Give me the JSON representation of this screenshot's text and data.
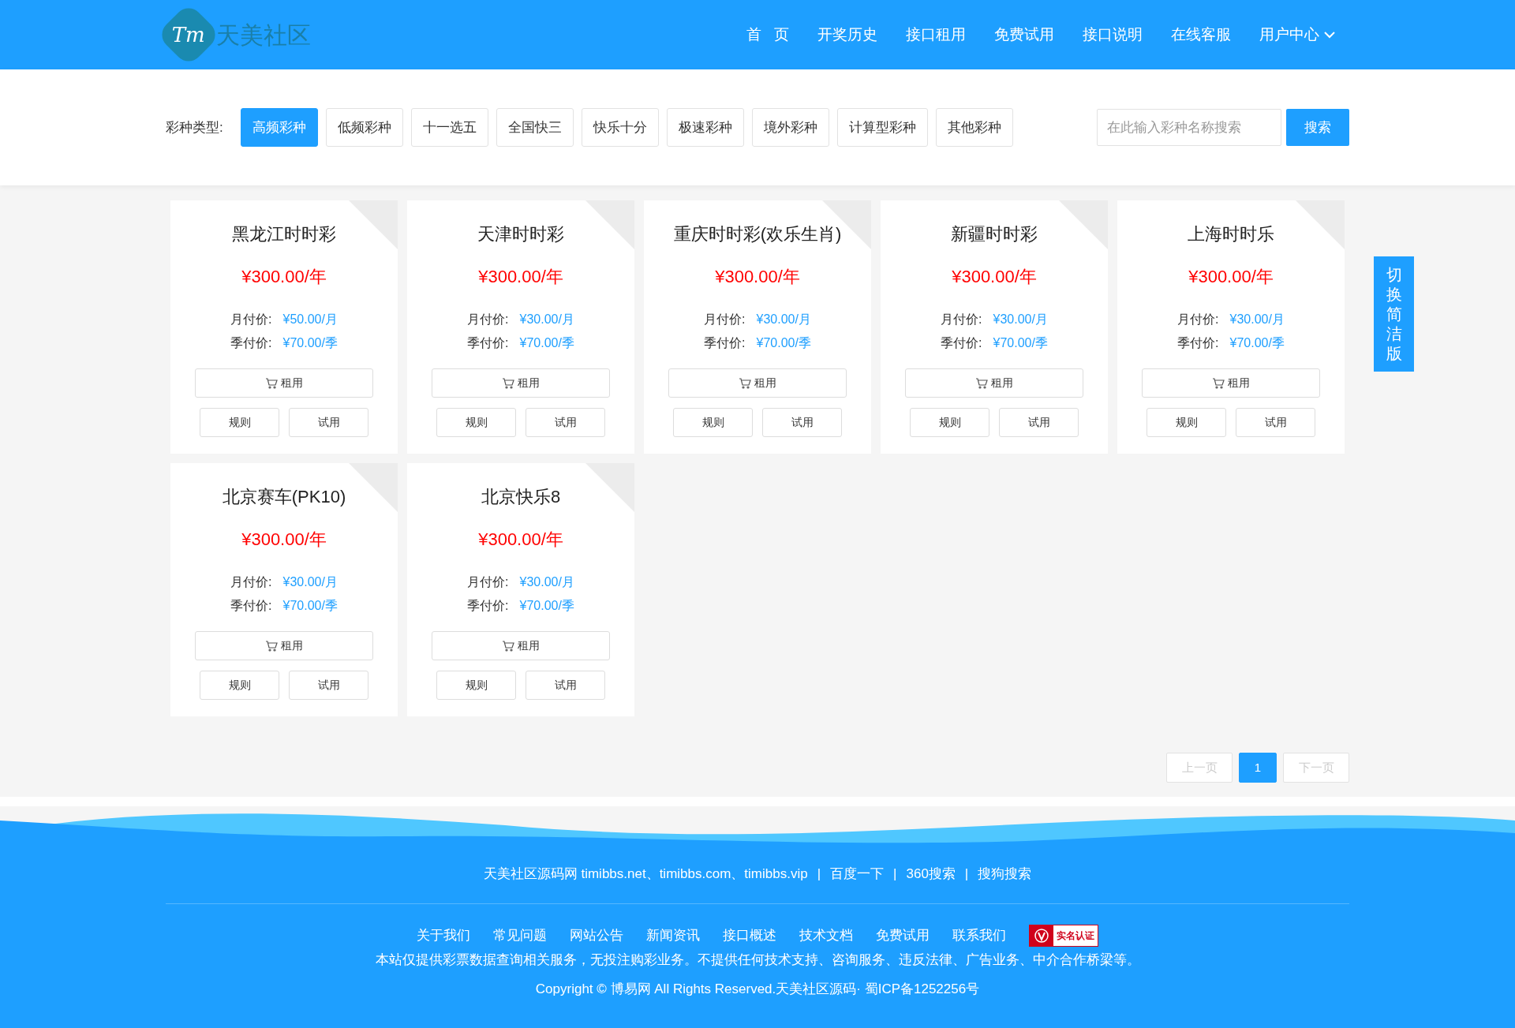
{
  "header": {
    "logo_mark": "Tm",
    "logo_text": "天美社区",
    "nav": [
      {
        "label": "首 页",
        "kind": "link"
      },
      {
        "label": "开奖历史",
        "kind": "link"
      },
      {
        "label": "接口租用",
        "kind": "link"
      },
      {
        "label": "免费试用",
        "kind": "link"
      },
      {
        "label": "接口说明",
        "kind": "link"
      },
      {
        "label": "在线客服",
        "kind": "link"
      },
      {
        "label": "用户中心",
        "kind": "dropdown"
      }
    ]
  },
  "filter": {
    "label": "彩种类型:",
    "types": [
      {
        "label": "高频彩种",
        "selected": true
      },
      {
        "label": "低频彩种",
        "selected": false
      },
      {
        "label": "十一选五",
        "selected": false
      },
      {
        "label": "全国快三",
        "selected": false
      },
      {
        "label": "快乐十分",
        "selected": false
      },
      {
        "label": "极速彩种",
        "selected": false
      },
      {
        "label": "境外彩种",
        "selected": false
      },
      {
        "label": "计算型彩种",
        "selected": false
      },
      {
        "label": "其他彩种",
        "selected": false
      }
    ],
    "search": {
      "placeholder": "在此输入彩种名称搜索",
      "button": "搜索"
    }
  },
  "cards": [
    {
      "title": "黑龙江时时彩",
      "price": "¥300.00/年",
      "monthly_label": "月付价:",
      "monthly": "¥50.00/月",
      "quarterly_label": "季付价:",
      "quarterly": "¥70.00/季",
      "rent": "租用",
      "rules": "规则",
      "trial": "试用"
    },
    {
      "title": "天津时时彩",
      "price": "¥300.00/年",
      "monthly_label": "月付价:",
      "monthly": "¥30.00/月",
      "quarterly_label": "季付价:",
      "quarterly": "¥70.00/季",
      "rent": "租用",
      "rules": "规则",
      "trial": "试用"
    },
    {
      "title": "重庆时时彩(欢乐生肖)",
      "price": "¥300.00/年",
      "monthly_label": "月付价:",
      "monthly": "¥30.00/月",
      "quarterly_label": "季付价:",
      "quarterly": "¥70.00/季",
      "rent": "租用",
      "rules": "规则",
      "trial": "试用"
    },
    {
      "title": "新疆时时彩",
      "price": "¥300.00/年",
      "monthly_label": "月付价:",
      "monthly": "¥30.00/月",
      "quarterly_label": "季付价:",
      "quarterly": "¥70.00/季",
      "rent": "租用",
      "rules": "规则",
      "trial": "试用"
    },
    {
      "title": "上海时时乐",
      "price": "¥300.00/年",
      "monthly_label": "月付价:",
      "monthly": "¥30.00/月",
      "quarterly_label": "季付价:",
      "quarterly": "¥70.00/季",
      "rent": "租用",
      "rules": "规则",
      "trial": "试用"
    },
    {
      "title": "北京赛车(PK10)",
      "price": "¥300.00/年",
      "monthly_label": "月付价:",
      "monthly": "¥30.00/月",
      "quarterly_label": "季付价:",
      "quarterly": "¥70.00/季",
      "rent": "租用",
      "rules": "规则",
      "trial": "试用"
    },
    {
      "title": "北京快乐8",
      "price": "¥300.00/年",
      "monthly_label": "月付价:",
      "monthly": "¥30.00/月",
      "quarterly_label": "季付价:",
      "quarterly": "¥70.00/季",
      "rent": "租用",
      "rules": "规则",
      "trial": "试用"
    }
  ],
  "pagination": [
    {
      "label": "上一页",
      "kind": "nav",
      "disabled": true,
      "selected": false
    },
    {
      "label": "1",
      "kind": "page",
      "disabled": false,
      "selected": true
    },
    {
      "label": "下一页",
      "kind": "nav",
      "disabled": true,
      "selected": false
    }
  ],
  "side_tab": "切换简洁版",
  "footer": {
    "line1": [
      "天美社区源码网 timibbs.net、timibbs.com、timibbs.vip",
      "百度一下",
      "360搜索",
      "搜狗搜索"
    ],
    "separator": "|",
    "links": [
      "关于我们",
      "常见问题",
      "网站公告",
      "新闻资讯",
      "接口概述",
      "技术文档",
      "免费试用",
      "联系我们"
    ],
    "badge": "实名认证",
    "disclaimer": "本站仅提供彩票数据查询相关服务，无投注购彩业务。不提供任何技术支持、咨询服务、违反法律、广告业务、中介合作桥梁等。",
    "copyright": "Copyright © 博易网 All Rights Reserved.天美社区源码· 蜀ICP备1252256号"
  }
}
